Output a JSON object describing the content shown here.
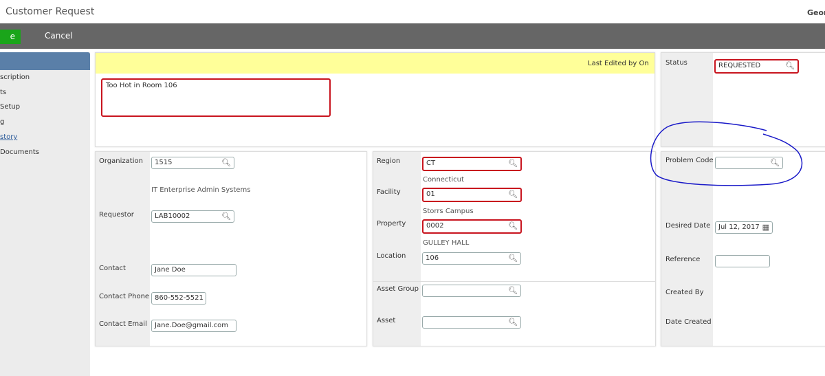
{
  "header": {
    "title": "Customer Request",
    "user": "Geor"
  },
  "toolbar": {
    "save_label": "e",
    "cancel_label": "Cancel"
  },
  "sidebar": {
    "items": [
      "scription",
      "ts",
      "Setup",
      "g",
      "story",
      "Documents"
    ]
  },
  "description": {
    "last_edited": "Last Edited by  On",
    "text": "Too Hot in Room 106"
  },
  "status": {
    "label": "Status",
    "value": "REQUESTED"
  },
  "left": {
    "organization_label": "Organization",
    "organization": "1515",
    "organization_name": "IT Enterprise Admin Systems",
    "requestor_label": "Requestor",
    "requestor": "LAB10002",
    "contact_label": "Contact",
    "contact": "Jane Doe",
    "phone_label": "Contact Phone",
    "phone": "860-552-5521",
    "email_label": "Contact Email",
    "email": "Jane.Doe@gmail.com"
  },
  "middle": {
    "region_label": "Region",
    "region": "CT",
    "region_name": "Connecticut",
    "facility_label": "Facility",
    "facility": "01",
    "facility_name": "Storrs Campus",
    "property_label": "Property",
    "property": "0002",
    "property_name": "GULLEY HALL",
    "location_label": "Location",
    "location": "106",
    "asset_group_label": "Asset Group",
    "asset_group": "",
    "asset_label": "Asset",
    "asset": ""
  },
  "right": {
    "problem_code_label": "Problem Code",
    "problem_code": "",
    "desired_date_label": "Desired Date",
    "desired_date": "Jul 12, 2017",
    "reference_label": "Reference",
    "reference": "",
    "created_by_label": "Created By",
    "date_created_label": "Date Created"
  },
  "colors": {
    "toolbar": "#666666",
    "save": "#1aa51a",
    "required_border": "#c8141e",
    "annotation": "#1a1ac8",
    "sidebar_header": "#5a7fa8"
  }
}
